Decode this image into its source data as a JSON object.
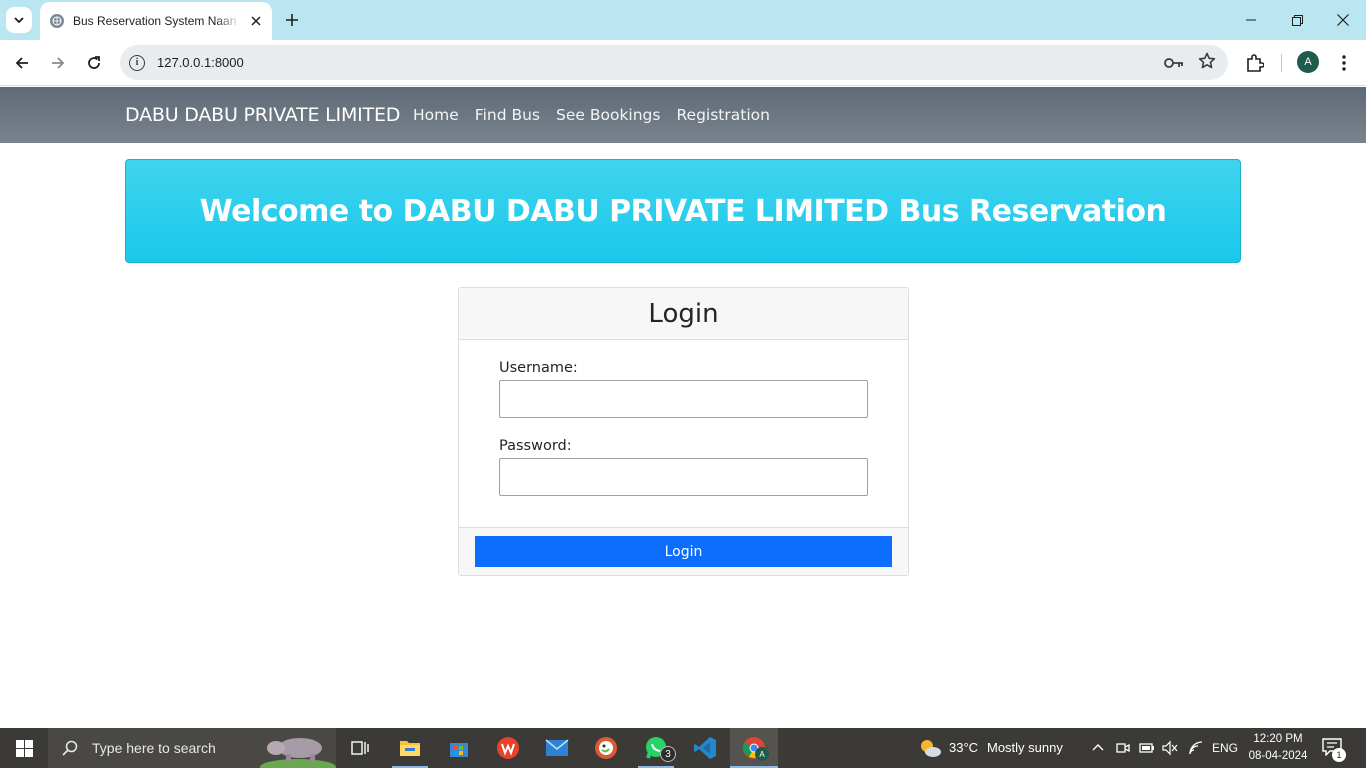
{
  "browser": {
    "tab_title": "Bus Reservation System Naan Mu",
    "url": "127.0.0.1:8000",
    "profile_initial": "A"
  },
  "site_nav": {
    "brand": "DABU DABU PRIVATE LIMITED",
    "links": [
      "Home",
      "Find Bus",
      "See Bookings",
      "Registration"
    ]
  },
  "hero": {
    "title": "Welcome to DABU DABU PRIVATE LIMITED Bus Reservation"
  },
  "login_card": {
    "title": "Login",
    "username_label": "Username:",
    "username_value": "",
    "password_label": "Password:",
    "password_value": "",
    "submit_label": "Login"
  },
  "taskbar": {
    "search_placeholder": "Type here to search",
    "whatsapp_badge": "3",
    "weather_temp": "33°C",
    "weather_text": "Mostly sunny",
    "language": "ENG",
    "time": "12:20 PM",
    "date": "08-04-2024",
    "notification_count": "1"
  },
  "colors": {
    "navbar": "#6c757d",
    "hero": "#22cdee",
    "primary_button": "#0d6efd",
    "tabstrip": "#b9e6f0",
    "taskbar": "#3c3a36"
  }
}
